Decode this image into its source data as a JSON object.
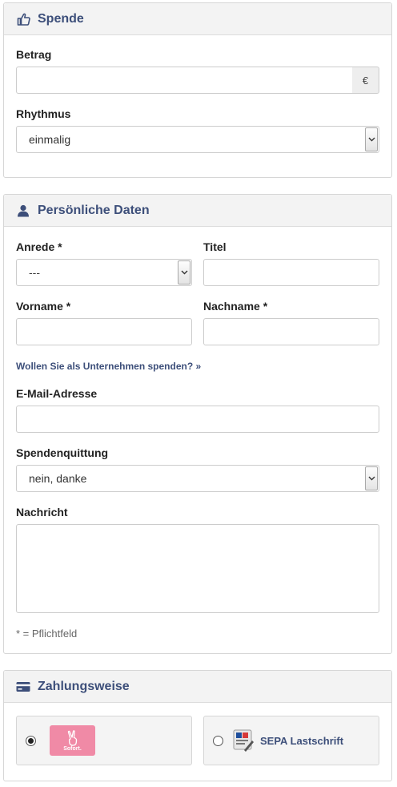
{
  "spende": {
    "title": "Spende",
    "icon": "thumbs-up-icon",
    "betrag_label": "Betrag",
    "betrag_value": "",
    "currency_symbol": "€",
    "rhythmus_label": "Rhythmus",
    "rhythmus_selected": "einmalig"
  },
  "personal": {
    "title": "Persönliche Daten",
    "icon": "user-icon",
    "anrede_label": "Anrede *",
    "anrede_selected": "---",
    "titel_label": "Titel",
    "titel_value": "",
    "vorname_label": "Vorname *",
    "vorname_value": "",
    "nachname_label": "Nachname *",
    "nachname_value": "",
    "company_link": "Wollen Sie als Unternehmen spenden? »",
    "email_label": "E-Mail-Adresse",
    "email_value": "",
    "quittung_label": "Spendenquittung",
    "quittung_selected": "nein, danke",
    "nachricht_label": "Nachricht",
    "nachricht_value": "",
    "pflicht_note": "* = Pflichtfeld"
  },
  "payment": {
    "title": "Zahlungsweise",
    "icon": "credit-card-icon",
    "options": [
      {
        "label": "Sofort.",
        "logo_color": "#f08aa6",
        "selected": true
      },
      {
        "label": "SEPA Lastschrift",
        "selected": false
      }
    ]
  },
  "colors": {
    "heading": "#3d4f7a",
    "panel_header_bg": "#f3f3f3",
    "border": "#cccccc"
  }
}
